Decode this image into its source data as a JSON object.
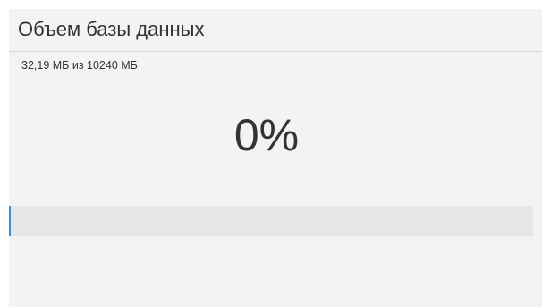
{
  "widget": {
    "title": "Объем базы данных",
    "usage_text": "32,19 МБ из 10240 МБ",
    "percent_label": "0%",
    "progress_fraction": 0.0031,
    "colors": {
      "panel_background": "#f3f3f3",
      "track": "#e6e6e6",
      "fill": "#3b8ed0",
      "text": "#333333"
    }
  }
}
